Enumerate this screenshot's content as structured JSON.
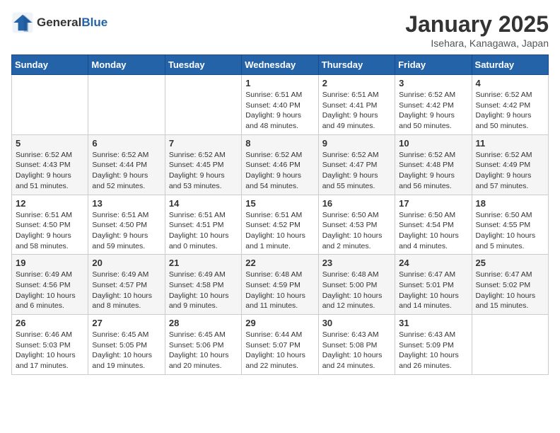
{
  "logo": {
    "general": "General",
    "blue": "Blue"
  },
  "header": {
    "title": "January 2025",
    "subtitle": "Isehara, Kanagawa, Japan"
  },
  "days_of_week": [
    "Sunday",
    "Monday",
    "Tuesday",
    "Wednesday",
    "Thursday",
    "Friday",
    "Saturday"
  ],
  "weeks": [
    [
      {
        "day": "",
        "info": ""
      },
      {
        "day": "",
        "info": ""
      },
      {
        "day": "",
        "info": ""
      },
      {
        "day": "1",
        "info": "Sunrise: 6:51 AM\nSunset: 4:40 PM\nDaylight: 9 hours and 48 minutes."
      },
      {
        "day": "2",
        "info": "Sunrise: 6:51 AM\nSunset: 4:41 PM\nDaylight: 9 hours and 49 minutes."
      },
      {
        "day": "3",
        "info": "Sunrise: 6:52 AM\nSunset: 4:42 PM\nDaylight: 9 hours and 50 minutes."
      },
      {
        "day": "4",
        "info": "Sunrise: 6:52 AM\nSunset: 4:42 PM\nDaylight: 9 hours and 50 minutes."
      }
    ],
    [
      {
        "day": "5",
        "info": "Sunrise: 6:52 AM\nSunset: 4:43 PM\nDaylight: 9 hours and 51 minutes."
      },
      {
        "day": "6",
        "info": "Sunrise: 6:52 AM\nSunset: 4:44 PM\nDaylight: 9 hours and 52 minutes."
      },
      {
        "day": "7",
        "info": "Sunrise: 6:52 AM\nSunset: 4:45 PM\nDaylight: 9 hours and 53 minutes."
      },
      {
        "day": "8",
        "info": "Sunrise: 6:52 AM\nSunset: 4:46 PM\nDaylight: 9 hours and 54 minutes."
      },
      {
        "day": "9",
        "info": "Sunrise: 6:52 AM\nSunset: 4:47 PM\nDaylight: 9 hours and 55 minutes."
      },
      {
        "day": "10",
        "info": "Sunrise: 6:52 AM\nSunset: 4:48 PM\nDaylight: 9 hours and 56 minutes."
      },
      {
        "day": "11",
        "info": "Sunrise: 6:52 AM\nSunset: 4:49 PM\nDaylight: 9 hours and 57 minutes."
      }
    ],
    [
      {
        "day": "12",
        "info": "Sunrise: 6:51 AM\nSunset: 4:50 PM\nDaylight: 9 hours and 58 minutes."
      },
      {
        "day": "13",
        "info": "Sunrise: 6:51 AM\nSunset: 4:50 PM\nDaylight: 9 hours and 59 minutes."
      },
      {
        "day": "14",
        "info": "Sunrise: 6:51 AM\nSunset: 4:51 PM\nDaylight: 10 hours and 0 minutes."
      },
      {
        "day": "15",
        "info": "Sunrise: 6:51 AM\nSunset: 4:52 PM\nDaylight: 10 hours and 1 minute."
      },
      {
        "day": "16",
        "info": "Sunrise: 6:50 AM\nSunset: 4:53 PM\nDaylight: 10 hours and 2 minutes."
      },
      {
        "day": "17",
        "info": "Sunrise: 6:50 AM\nSunset: 4:54 PM\nDaylight: 10 hours and 4 minutes."
      },
      {
        "day": "18",
        "info": "Sunrise: 6:50 AM\nSunset: 4:55 PM\nDaylight: 10 hours and 5 minutes."
      }
    ],
    [
      {
        "day": "19",
        "info": "Sunrise: 6:49 AM\nSunset: 4:56 PM\nDaylight: 10 hours and 6 minutes."
      },
      {
        "day": "20",
        "info": "Sunrise: 6:49 AM\nSunset: 4:57 PM\nDaylight: 10 hours and 8 minutes."
      },
      {
        "day": "21",
        "info": "Sunrise: 6:49 AM\nSunset: 4:58 PM\nDaylight: 10 hours and 9 minutes."
      },
      {
        "day": "22",
        "info": "Sunrise: 6:48 AM\nSunset: 4:59 PM\nDaylight: 10 hours and 11 minutes."
      },
      {
        "day": "23",
        "info": "Sunrise: 6:48 AM\nSunset: 5:00 PM\nDaylight: 10 hours and 12 minutes."
      },
      {
        "day": "24",
        "info": "Sunrise: 6:47 AM\nSunset: 5:01 PM\nDaylight: 10 hours and 14 minutes."
      },
      {
        "day": "25",
        "info": "Sunrise: 6:47 AM\nSunset: 5:02 PM\nDaylight: 10 hours and 15 minutes."
      }
    ],
    [
      {
        "day": "26",
        "info": "Sunrise: 6:46 AM\nSunset: 5:03 PM\nDaylight: 10 hours and 17 minutes."
      },
      {
        "day": "27",
        "info": "Sunrise: 6:45 AM\nSunset: 5:05 PM\nDaylight: 10 hours and 19 minutes."
      },
      {
        "day": "28",
        "info": "Sunrise: 6:45 AM\nSunset: 5:06 PM\nDaylight: 10 hours and 20 minutes."
      },
      {
        "day": "29",
        "info": "Sunrise: 6:44 AM\nSunset: 5:07 PM\nDaylight: 10 hours and 22 minutes."
      },
      {
        "day": "30",
        "info": "Sunrise: 6:43 AM\nSunset: 5:08 PM\nDaylight: 10 hours and 24 minutes."
      },
      {
        "day": "31",
        "info": "Sunrise: 6:43 AM\nSunset: 5:09 PM\nDaylight: 10 hours and 26 minutes."
      },
      {
        "day": "",
        "info": ""
      }
    ]
  ]
}
